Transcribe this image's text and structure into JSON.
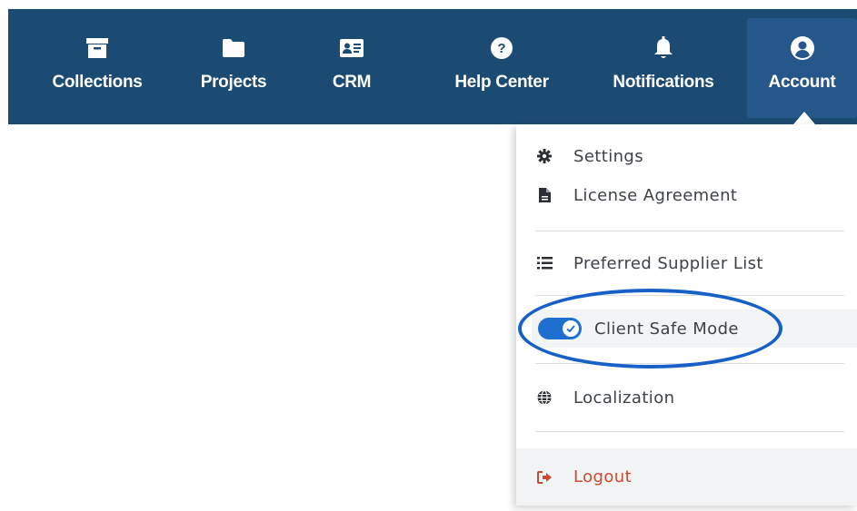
{
  "nav": {
    "items": [
      {
        "label": "Collections",
        "icon": "archive-icon"
      },
      {
        "label": "Projects",
        "icon": "folder-icon"
      },
      {
        "label": "CRM",
        "icon": "contact-card-icon"
      },
      {
        "label": "Help Center",
        "icon": "question-circle-icon"
      },
      {
        "label": "Notifications",
        "icon": "bell-icon"
      },
      {
        "label": "Account",
        "icon": "user-circle-icon",
        "active": true
      }
    ],
    "bar_color": "#1b4a73",
    "active_color": "#26578a"
  },
  "account_menu": {
    "settings": {
      "label": "Settings",
      "icon": "gear-icon"
    },
    "license": {
      "label": "License Agreement",
      "icon": "document-icon"
    },
    "supplier": {
      "label": "Preferred Supplier List",
      "icon": "list-icon"
    },
    "client_safe": {
      "label": "Client Safe Mode",
      "icon": "toggle-icon",
      "enabled": true
    },
    "localization": {
      "label": "Localization",
      "icon": "globe-icon"
    },
    "logout": {
      "label": "Logout",
      "icon": "sign-out-icon",
      "color": "#c94b2f"
    }
  },
  "annotation": {
    "color": "#1760c8"
  }
}
